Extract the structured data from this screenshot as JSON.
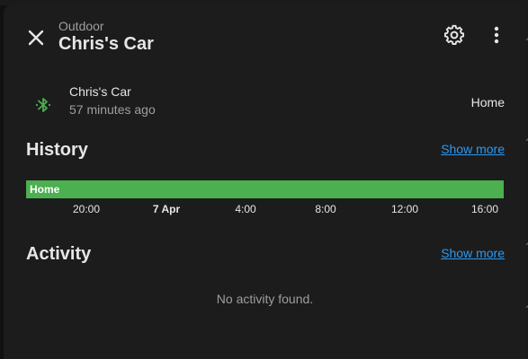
{
  "header": {
    "area": "Outdoor",
    "title": "Chris's Car"
  },
  "entity": {
    "name": "Chris's Car",
    "last_changed": "57 minutes ago",
    "state": "Home",
    "icon": "bluetooth-icon",
    "icon_color": "#4caf50"
  },
  "history": {
    "title": "History",
    "show_more": "Show more",
    "bar_label": "Home",
    "bar_color": "#4caf50",
    "ticks": [
      "20:00",
      "7 Apr",
      "4:00",
      "8:00",
      "12:00",
      "16:00"
    ]
  },
  "activity": {
    "title": "Activity",
    "show_more": "Show more",
    "empty_text": "No activity found."
  },
  "colors": {
    "dialog_bg": "#1c1c1c",
    "link": "#2b9af3",
    "text_primary": "#e6e6e6",
    "text_secondary": "#9e9e9e"
  }
}
